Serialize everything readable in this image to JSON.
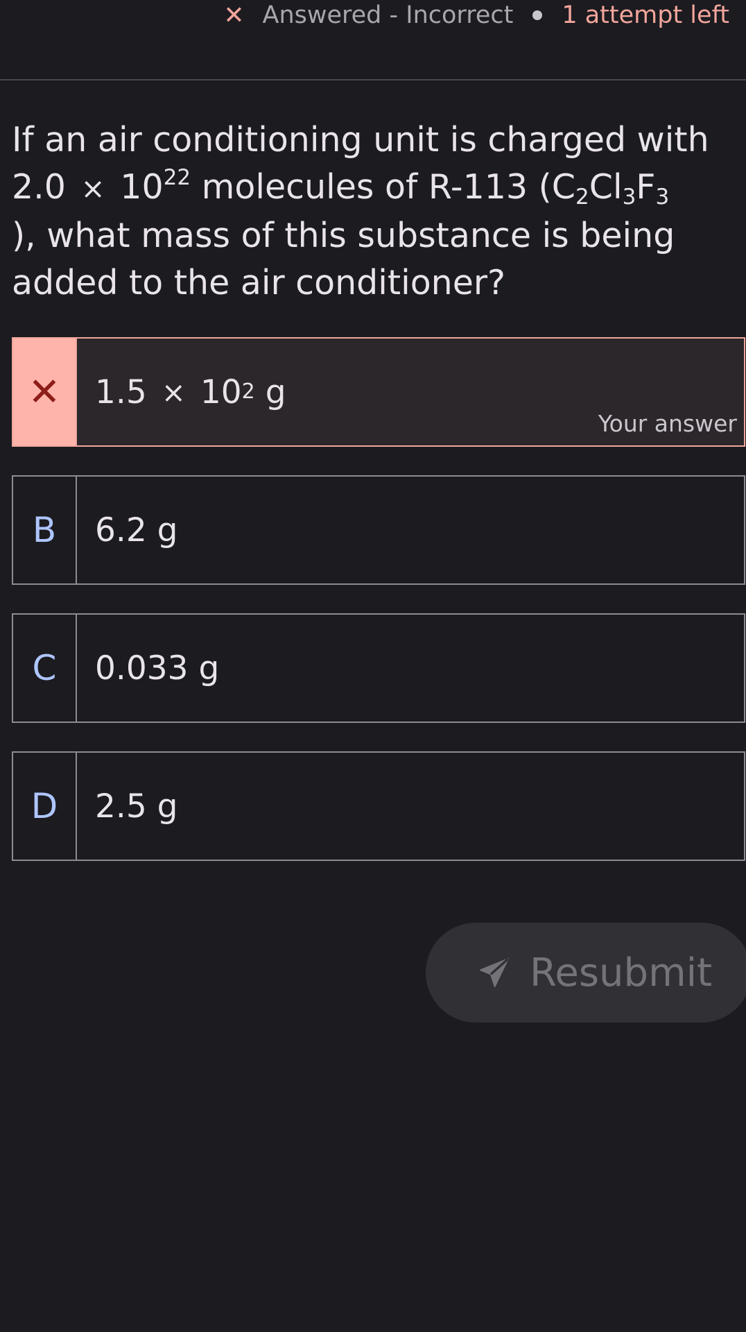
{
  "status": {
    "icon": "close-icon",
    "state_label": "Answered - Incorrect",
    "attempts_label": "1 attempt left"
  },
  "question": {
    "line1": "If an air conditioning unit is charged with",
    "line2_coef": "2.0",
    "times": "×",
    "line2_base": "10",
    "line2_exp": "22",
    "line2_rest": " molecules of R-113 (C",
    "sub1": "2",
    "cl": "Cl",
    "sub2": "3",
    "f": "F",
    "sub3": "3",
    "line3": "), what mass of this substance is being",
    "line4": "added to the air conditioner?"
  },
  "options": [
    {
      "marker_icon": "close-icon",
      "marker": "✕",
      "coef": "1.5",
      "times": "×",
      "base": "10",
      "exp": "2",
      "unit": " g",
      "note": "Your answer",
      "status": "incorrect"
    },
    {
      "letter": "B",
      "text": "6.2 g"
    },
    {
      "letter": "C",
      "text": "0.033 g"
    },
    {
      "letter": "D",
      "text": "2.5 g"
    }
  ],
  "resubmit": {
    "icon": "send-icon",
    "label": "Resubmit"
  },
  "colors": {
    "background": "#1c1b20",
    "error": "#ffb4ab",
    "error_text": "#f2a69c",
    "letter": "#aec6ff"
  }
}
